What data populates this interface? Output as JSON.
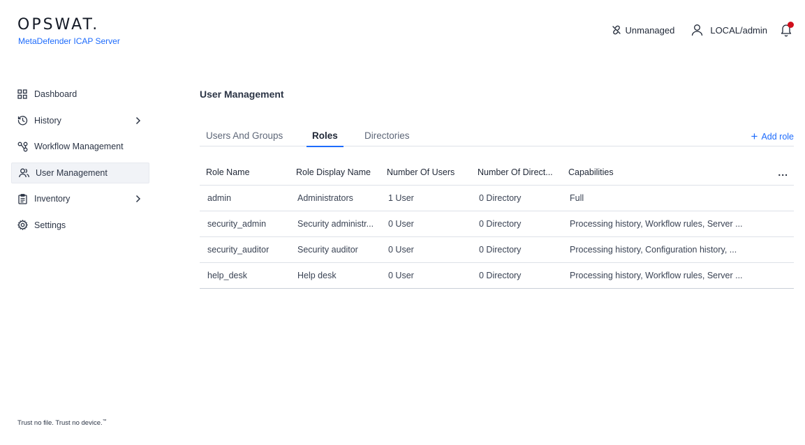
{
  "brand": {
    "logo": "OPSWAT.",
    "product": "MetaDefender ICAP Server"
  },
  "header": {
    "unmanaged": "Unmanaged",
    "user": "LOCAL/admin",
    "icons": {
      "unmanaged": "unlink-icon",
      "user": "user-icon",
      "notifications": "bell-icon"
    },
    "notification_dot_color": "#d00f1c"
  },
  "sidebar": {
    "items": [
      {
        "label": "Dashboard",
        "icon": "grid-icon"
      },
      {
        "label": "History",
        "icon": "history-icon",
        "has_submenu": true
      },
      {
        "label": "Workflow Management",
        "icon": "workflow-icon"
      },
      {
        "label": "User Management",
        "icon": "users-icon",
        "active": true
      },
      {
        "label": "Inventory",
        "icon": "clipboard-icon",
        "has_submenu": true
      },
      {
        "label": "Settings",
        "icon": "gear-icon"
      }
    ],
    "tagline": "Trust no file. Trust no device.",
    "tagline_mark": "™"
  },
  "main": {
    "title": "User Management",
    "tabs": [
      {
        "label": "Users And Groups",
        "active": false
      },
      {
        "label": "Roles",
        "active": true
      },
      {
        "label": "Directories",
        "active": false
      }
    ],
    "add_role": "Add role",
    "table": {
      "columns": [
        "Role Name",
        "Role Display Name",
        "Number Of Users",
        "Number Of Direct...",
        "Capabilities"
      ],
      "menu": "...",
      "rows": [
        {
          "role_name": "admin",
          "display_name": "Administrators",
          "users": "1 User",
          "directories": "0 Directory",
          "capabilities": "Full"
        },
        {
          "role_name": "security_admin",
          "display_name": "Security administr...",
          "users": "0 User",
          "directories": "0 Directory",
          "capabilities": "Processing history, Workflow rules, Server ..."
        },
        {
          "role_name": "security_auditor",
          "display_name": "Security auditor",
          "users": "0 User",
          "directories": "0 Directory",
          "capabilities": "Processing history, Configuration history, ..."
        },
        {
          "role_name": "help_desk",
          "display_name": "Help desk",
          "users": "0 User",
          "directories": "0 Directory",
          "capabilities": "Processing history, Workflow rules, Server ..."
        }
      ]
    }
  },
  "colors": {
    "accent": "#1d6bfc",
    "text": "#2b3445",
    "active_nav_bg": "#f1f3f7"
  }
}
